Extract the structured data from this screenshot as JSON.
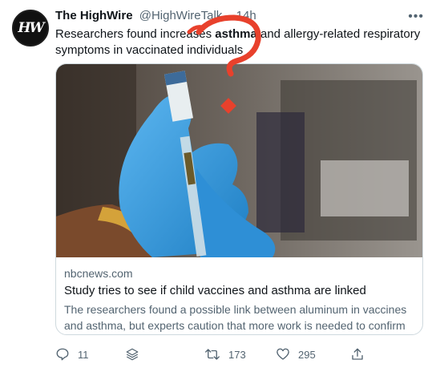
{
  "tweet": {
    "author_name": "The HighWire",
    "author_handle": "@HighWireTalk",
    "time": "· 14h",
    "avatar_text": "HW",
    "text_before": "Researchers found increases ",
    "text_bold": "asthma",
    "text_after": " and allergy-related respiratory symptoms in vaccinated individuals"
  },
  "card": {
    "domain": "nbcnews.com",
    "title": "Study tries to see if child vaccines and asthma are linked",
    "description": "The researchers found a possible link between aluminum in vaccines and asthma, but experts caution that more work is needed to confirm …"
  },
  "actions": {
    "replies": "11",
    "retweets": "173",
    "likes": "295"
  },
  "icons": [
    "more-icon",
    "reply-icon",
    "stack-icon",
    "retweet-icon",
    "like-icon",
    "share-icon"
  ],
  "colors": {
    "annotation": "#e8412c",
    "text_secondary": "#536471",
    "glove": "#3aa0e3"
  }
}
